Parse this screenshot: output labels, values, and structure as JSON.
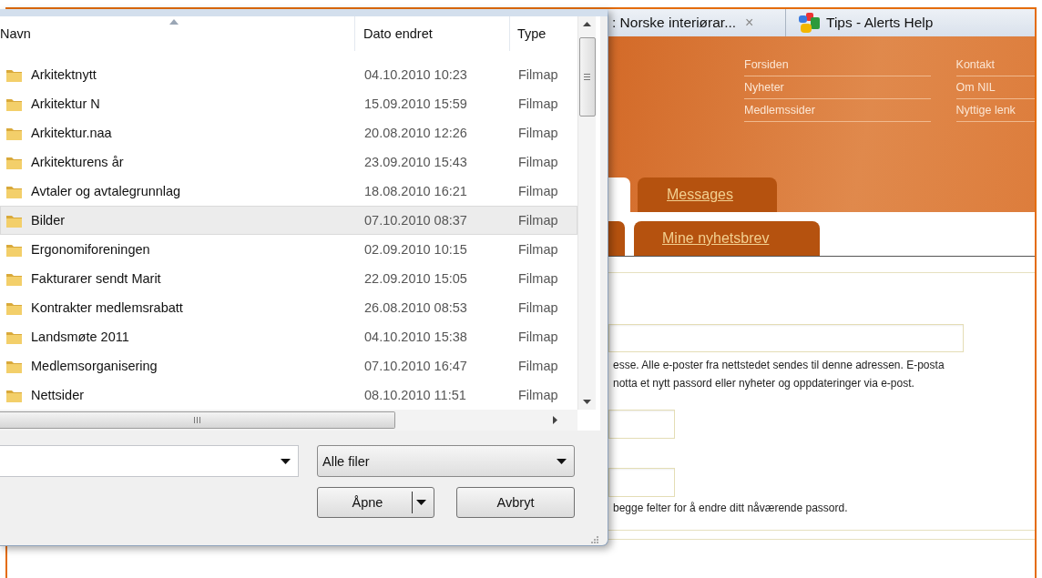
{
  "dialog": {
    "columns": [
      {
        "label": "Navn",
        "sorted": true
      },
      {
        "label": "Dato endret",
        "sorted": false
      },
      {
        "label": "Type",
        "sorted": false
      }
    ],
    "files": [
      {
        "name": "Arkitektnytt",
        "modified": "04.10.2010 10:23",
        "type": "Filmap",
        "selected": false
      },
      {
        "name": "Arkitektur N",
        "modified": "15.09.2010 15:59",
        "type": "Filmap",
        "selected": false
      },
      {
        "name": "Arkitektur.naa",
        "modified": "20.08.2010 12:26",
        "type": "Filmap",
        "selected": false
      },
      {
        "name": "Arkitekturens år",
        "modified": "23.09.2010 15:43",
        "type": "Filmap",
        "selected": false
      },
      {
        "name": "Avtaler og avtalegrunnlag",
        "modified": "18.08.2010 16:21",
        "type": "Filmap",
        "selected": false
      },
      {
        "name": "Bilder",
        "modified": "07.10.2010 08:37",
        "type": "Filmap",
        "selected": true
      },
      {
        "name": "Ergonomiforeningen",
        "modified": "02.09.2010 10:15",
        "type": "Filmap",
        "selected": false
      },
      {
        "name": "Fakturarer sendt Marit",
        "modified": "22.09.2010 15:05",
        "type": "Filmap",
        "selected": false
      },
      {
        "name": "Kontrakter medlemsrabatt",
        "modified": "26.08.2010 08:53",
        "type": "Filmap",
        "selected": false
      },
      {
        "name": "Landsmøte 2011",
        "modified": "04.10.2010 15:38",
        "type": "Filmap",
        "selected": false
      },
      {
        "name": "Medlemsorganisering",
        "modified": "07.10.2010 16:47",
        "type": "Filmap",
        "selected": false
      },
      {
        "name": "Nettsider",
        "modified": "08.10.2010 11:51",
        "type": "Filmap",
        "selected": false
      }
    ],
    "file_type": "Alle filer",
    "buttons": [
      {
        "label": "Åpne",
        "kind": "split"
      },
      {
        "label": "Avbryt",
        "kind": "plain"
      }
    ]
  },
  "browser": {
    "tabs": [
      {
        "title": ": Norske interiørar...",
        "close": "×",
        "kind": "plain"
      },
      {
        "title": "Tips - Alerts Help",
        "kind": "icon"
      }
    ]
  },
  "site": {
    "nav_columns": [
      {
        "links": [
          "Forsiden",
          "Nyheter",
          "Medlemssider"
        ]
      },
      {
        "links": [
          "Kontakt",
          "Om NIL",
          "Nyttige lenk"
        ]
      }
    ],
    "tabs_row_1": [
      {
        "selected": true
      },
      {
        "label": "Messages",
        "selected": false
      }
    ],
    "tabs_row_2": [
      {
        "selected": false
      },
      {
        "label": "Mine nyhetsbrev",
        "selected": false
      }
    ],
    "email_help": [
      "esse. Alle e-poster fra nettstedet sendes til denne adressen. E-posta",
      "notta et nytt passord eller nyheter og oppdateringer via e-post."
    ],
    "password_help": "begge felter for å endre ditt nåværende passord."
  }
}
